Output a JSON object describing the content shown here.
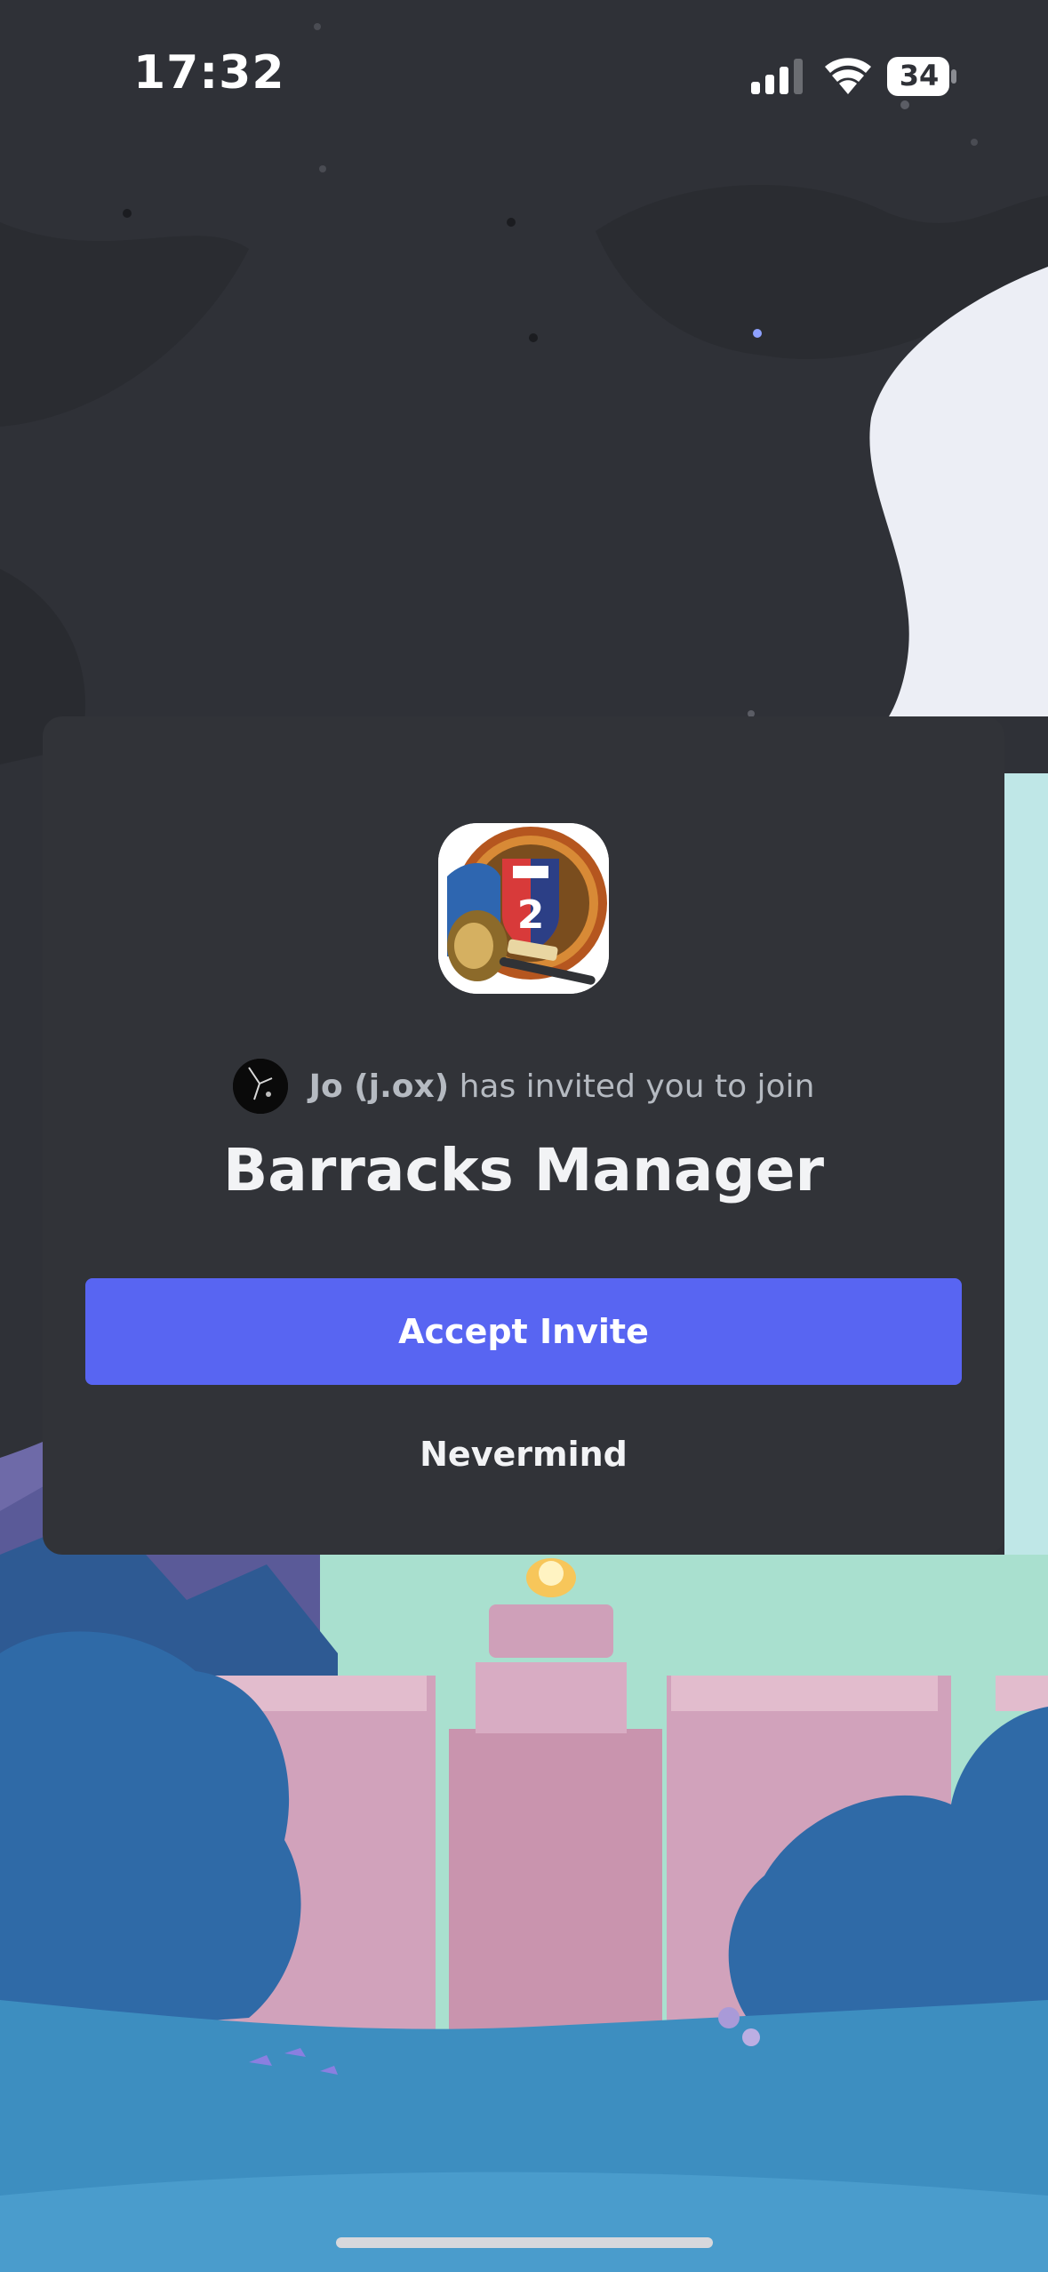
{
  "status_bar": {
    "time": "17:32",
    "battery_level": "34",
    "icons": [
      "cellular-signal-icon",
      "wifi-icon",
      "battery-icon"
    ]
  },
  "invite": {
    "inviter": "Jo (j.ox)",
    "text": " has invited you to join",
    "server_name": "Barracks Manager",
    "server_icon": "server-emblem-icon",
    "accept_label": "Accept Invite",
    "cancel_label": "Nevermind"
  },
  "colors": {
    "accent": "#5865f2",
    "modal_bg": "#313338",
    "page_bg": "#2f3137"
  }
}
